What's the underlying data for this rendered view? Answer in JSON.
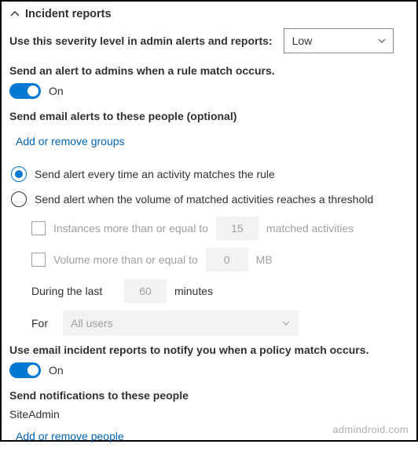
{
  "header": {
    "title": "Incident reports"
  },
  "severity": {
    "label": "Use this severity level in admin alerts and reports:",
    "value": "Low"
  },
  "adminAlert": {
    "label": "Send an alert to admins when a rule match occurs.",
    "state": "On"
  },
  "emailAlerts": {
    "label": "Send email alerts to these people (optional)",
    "link": "Add or remove groups"
  },
  "alertMode": {
    "every": "Send alert every time an activity matches the rule",
    "threshold": "Send alert when the volume of matched activities reaches a threshold"
  },
  "threshold": {
    "instancesLabelA": "Instances more than or equal to",
    "instancesValue": "15",
    "instancesLabelB": "matched activities",
    "volumeLabelA": "Volume more than or equal to",
    "volumeValue": "0",
    "volumeLabelB": "MB",
    "duringLabelA": "During the last",
    "duringValue": "60",
    "duringLabelB": "minutes",
    "forLabel": "For",
    "forValue": "All users"
  },
  "incidentEmail": {
    "label": "Use email incident reports to notify you when a policy match occurs.",
    "state": "On"
  },
  "notify": {
    "label": "Send notifications to these people",
    "person": "SiteAdmin",
    "link": "Add or remove people"
  },
  "watermark": "admindroid.com"
}
